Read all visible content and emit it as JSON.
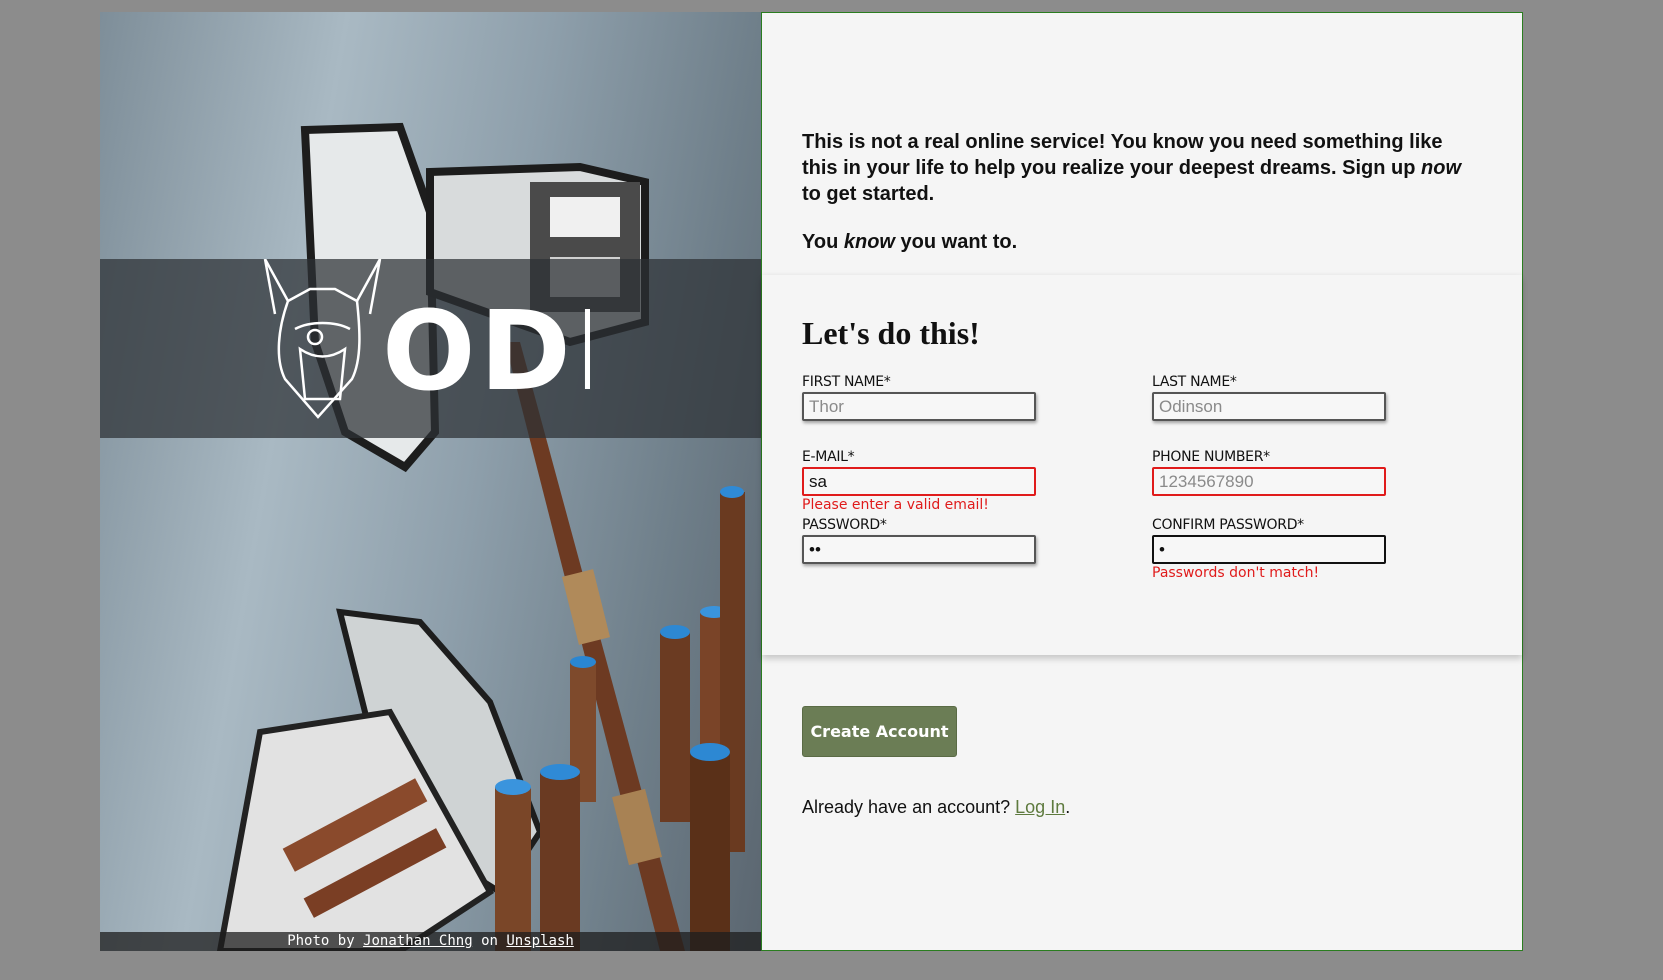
{
  "hero": {
    "logo_text": "ODIN",
    "credit": {
      "prefix": "Photo by",
      "author": "Jonathan Chng",
      "middle": "on",
      "site": "Unsplash"
    }
  },
  "intro": {
    "line1_a": "This is not a real online service! You know you need something like this in your life to help you realize your deepest dreams. Sign up ",
    "line1_em": "now",
    "line1_b": " to get started.",
    "line2_a": "You ",
    "line2_em": "know",
    "line2_b": " you want to."
  },
  "form": {
    "title": "Let's do this!",
    "first_name": {
      "label": "FIRST NAME*",
      "placeholder": "Thor",
      "value": ""
    },
    "last_name": {
      "label": "LAST NAME*",
      "placeholder": "Odinson",
      "value": ""
    },
    "email": {
      "label": "E-MAIL*",
      "value": "sa",
      "error": "Please enter a valid email!"
    },
    "phone": {
      "label": "PHONE NUMBER*",
      "placeholder": "1234567890",
      "value": ""
    },
    "password": {
      "label": "PASSWORD*",
      "value": "••"
    },
    "confirm_password": {
      "label": "CONFIRM PASSWORD*",
      "value": "•",
      "error": "Passwords don't match!"
    }
  },
  "actions": {
    "create_label": "Create Account",
    "login_prompt": "Already have an account? ",
    "login_link": "Log In",
    "login_suffix": "."
  },
  "colors": {
    "accent": "#6b7d55",
    "error": "#e01b1b",
    "panel_border": "#2a7d1f",
    "link": "#5e7a3e"
  }
}
